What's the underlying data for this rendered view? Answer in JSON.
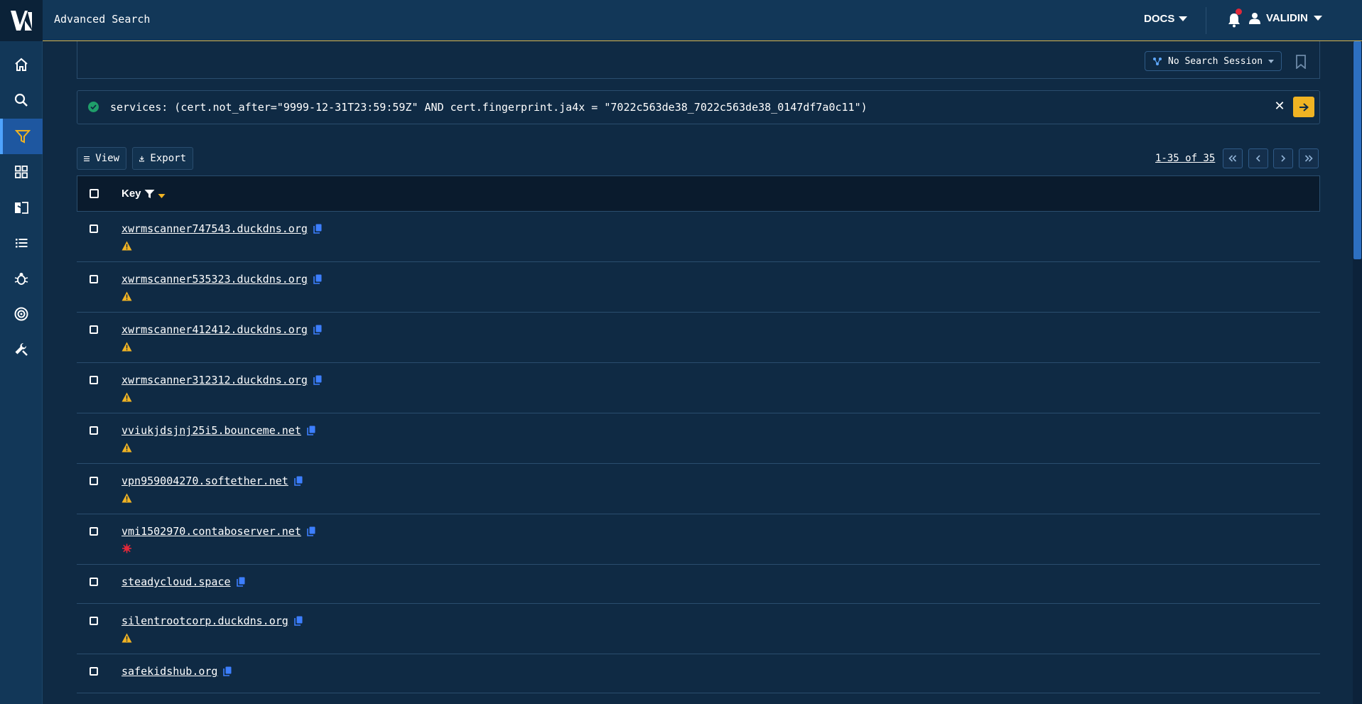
{
  "header": {
    "title": "Advanced Search",
    "docs_label": "DOCS",
    "user_label": "VALIDIN"
  },
  "sidebar": {
    "items": [
      {
        "icon": "home-icon"
      },
      {
        "icon": "search-icon"
      },
      {
        "icon": "filter-icon",
        "active": true
      },
      {
        "icon": "grid-icon"
      },
      {
        "icon": "compare-icon"
      },
      {
        "icon": "list-icon"
      },
      {
        "icon": "bug-icon"
      },
      {
        "icon": "target-icon"
      },
      {
        "icon": "wrench-icon"
      }
    ]
  },
  "session": {
    "label": "No Search Session"
  },
  "query": {
    "text": "services: (cert.not_after=\"9999-12-31T23:59:59Z\" AND cert.fingerprint.ja4x = \"7022c563de38_7022c563de38_0147df7a0c11\")"
  },
  "toolbar": {
    "view_label": "View",
    "export_label": "Export",
    "pager_text": "1-35 of 35"
  },
  "table": {
    "header_key": "Key",
    "rows": [
      {
        "key": "xwrmscanner747543.duckdns.org",
        "flag": "warning"
      },
      {
        "key": "xwrmscanner535323.duckdns.org",
        "flag": "warning"
      },
      {
        "key": "xwrmscanner412412.duckdns.org",
        "flag": "warning"
      },
      {
        "key": "xwrmscanner312312.duckdns.org",
        "flag": "warning"
      },
      {
        "key": "vviukjdsjnj25i5.bounceme.net",
        "flag": "warning"
      },
      {
        "key": "vpn959004270.softether.net",
        "flag": "warning"
      },
      {
        "key": "vmi1502970.contaboserver.net",
        "flag": "malware"
      },
      {
        "key": "steadycloud.space",
        "flag": "none"
      },
      {
        "key": "silentrootcorp.duckdns.org",
        "flag": "warning"
      },
      {
        "key": "safekidshub.org",
        "flag": "none"
      }
    ]
  },
  "colors": {
    "accent": "#f0b323",
    "active_nav": "#1e57a0",
    "warning": "#f0b323",
    "malware": "#e0283a",
    "success": "#1f9e6a",
    "copy": "#3d7fff"
  }
}
